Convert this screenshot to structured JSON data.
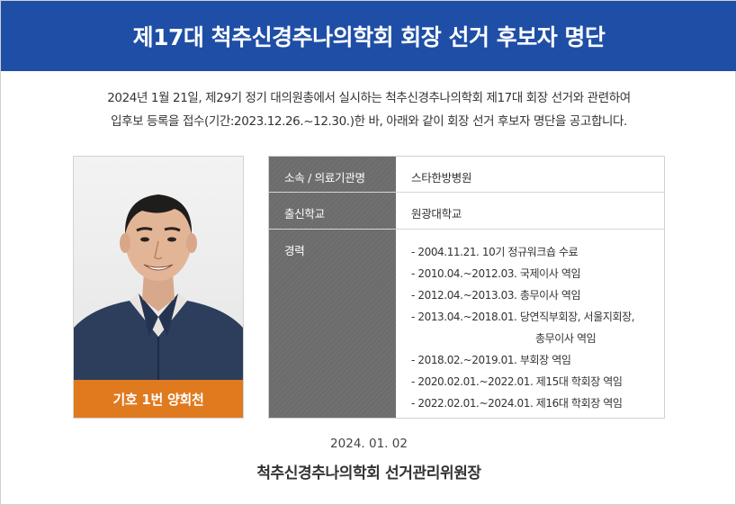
{
  "header": {
    "title": "제17대 척추신경추나의학회 회장 선거 후보자 명단"
  },
  "intro": {
    "line1": "2024년 1월 21일, 제29기 정기 대의원총에서 실시하는 척추신경추나의학회 제17대 회장 선거와 관련하여",
    "line2": "입후보 등록을 접수(기간:2023.12.26.~12.30.)한 바, 아래와 같이 회장 선거 후보자 명단을 공고합니다."
  },
  "candidate": {
    "name_label": "기호 1번 양회천",
    "affiliation_label": "소속 / 의료기관명",
    "affiliation_value": "스타한방병원",
    "school_label": "출신학교",
    "school_value": "원광대학교",
    "career_label": "경력",
    "career": [
      "- 2004.11.21. 10기 정규워크숍 수료",
      "- 2010.04.~2012.03. 국제이사 역임",
      "- 2012.04.~2013.03. 총무이사 역임",
      "- 2013.04.~2018.01. 당연직부회장, 서울지회장,",
      "총무이사 역임",
      "- 2018.02.~2019.01. 부회장 역임",
      "- 2020.02.01.~2022.01. 제15대 학회장 역임",
      "- 2022.02.01.~2024.01. 제16대 학회장 역임"
    ]
  },
  "footer": {
    "date": "2024. 01. 02",
    "committee": "척추신경추나의학회 선거관리위원장"
  },
  "colors": {
    "header": "#1f4ea6",
    "name_bar": "#e07a1f",
    "table_header": "#6c6c6c"
  }
}
